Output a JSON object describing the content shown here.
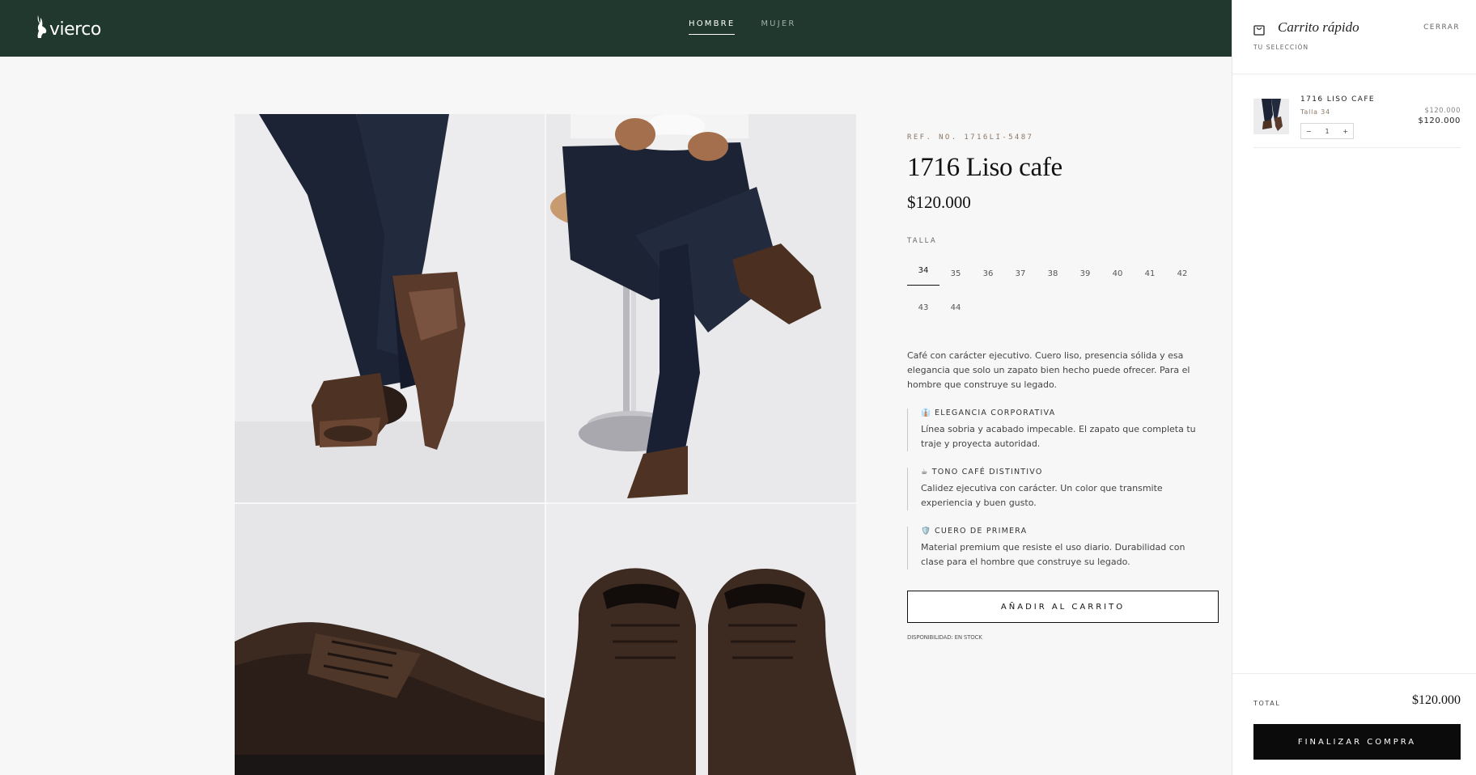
{
  "header": {
    "logo_text": "vierco",
    "nav": [
      {
        "label": "HOMBRE",
        "active": true
      },
      {
        "label": "MUJER",
        "active": false
      }
    ]
  },
  "product": {
    "ref": "REF. NO. 1716LI-5487",
    "title": "1716 Liso cafe",
    "price": "$120.000",
    "size_label": "TALLA",
    "sizes": [
      "34",
      "35",
      "36",
      "37",
      "38",
      "39",
      "40",
      "41",
      "42",
      "43",
      "44"
    ],
    "selected_size": "34",
    "description": "Café con carácter ejecutivo. Cuero liso, presencia sólida y esa elegancia que solo un zapato bien hecho puede ofrecer. Para el hombre que construye su legado.",
    "features": [
      {
        "icon": "👔",
        "icon_name": "necktie-icon",
        "title": "ELEGANCIA CORPORATIVA",
        "text": "Línea sobria y acabado impecable. El zapato que completa tu traje y proyecta autoridad."
      },
      {
        "icon": "☕",
        "icon_name": "coffee-icon",
        "title": "TONO CAFÉ DISTINTIVO",
        "text": "Calidez ejecutiva con carácter. Un color que transmite experiencia y buen gusto."
      },
      {
        "icon": "🛡️",
        "icon_name": "shield-icon",
        "title": "CUERO DE PRIMERA",
        "text": "Material premium que resiste el uso diario. Durabilidad con clase para el hombre que construye su legado."
      }
    ],
    "add_to_cart": "AÑADIR AL CARRITO",
    "availability": "DISPONIBILIDAD: EN STOCK"
  },
  "cart": {
    "title": "Carrito rápido",
    "subtitle": "TU SELECCIÓN",
    "close": "CERRAR",
    "items": [
      {
        "name": "1716 LISO CAFE",
        "size": "Talla 34",
        "qty": "1",
        "minus": "−",
        "plus": "+",
        "unit_price": "$120.000",
        "line_price": "$120.000"
      }
    ],
    "total_label": "TOTAL",
    "total_value": "$120.000",
    "checkout": "FINALIZAR COMPRA"
  },
  "colors": {
    "header_bg": "#20382e",
    "accent_brown": "#5a3a2a",
    "checkout_bg": "#0b0b0b"
  }
}
